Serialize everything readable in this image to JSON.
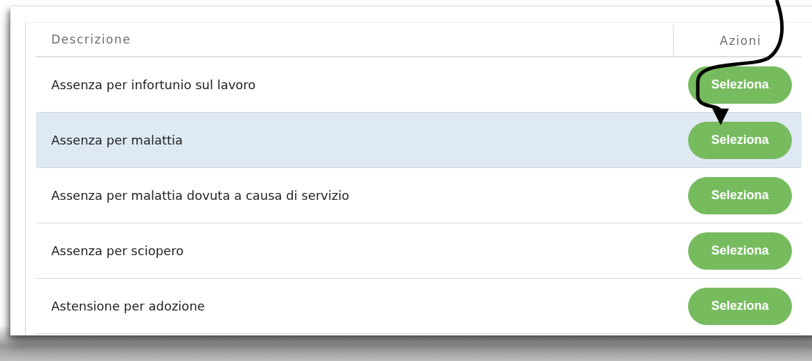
{
  "table": {
    "columns": [
      "Descrizione",
      "Azioni"
    ],
    "rows": [
      {
        "description": "Assenza per infortunio sul lavoro",
        "action": "Seleziona",
        "selected": false
      },
      {
        "description": "Assenza per malattia",
        "action": "Seleziona",
        "selected": true
      },
      {
        "description": "Assenza per malattia dovuta a causa di servizio",
        "action": "Seleziona",
        "selected": false
      },
      {
        "description": "Assenza per sciopero",
        "action": "Seleziona",
        "selected": false
      },
      {
        "description": "Astensione per adozione",
        "action": "Seleziona",
        "selected": false
      }
    ]
  }
}
